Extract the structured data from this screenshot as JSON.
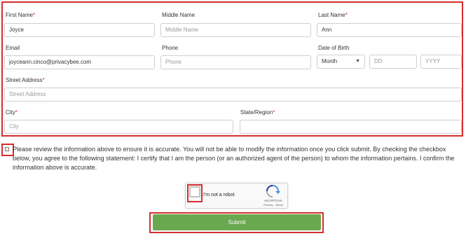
{
  "form": {
    "first_name": {
      "label": "First Name",
      "value": "Joyce"
    },
    "middle_name": {
      "label": "Middle Name",
      "placeholder": "Middle Name"
    },
    "last_name": {
      "label": "Last Name",
      "value": "Ann"
    },
    "email": {
      "label": "Email",
      "value": "joyceann.cinco@privacybee.com"
    },
    "phone": {
      "label": "Phone",
      "placeholder": "Phone"
    },
    "dob": {
      "label": "Date of Birth",
      "month": "Month",
      "day_placeholder": "DD",
      "year_placeholder": "YYYY"
    },
    "street": {
      "label": "Street Address",
      "placeholder": "Street Address"
    },
    "city": {
      "label": "City",
      "placeholder": "City"
    },
    "state": {
      "label": "State/Region",
      "placeholder": ""
    }
  },
  "required_marker": "*",
  "notice": "Please review the information above to ensure it is accurate. You will not be able to modify the information once you click submit. By checking the checkbox below, you agree to the following statement: I certify that I am the person (or an authorized agent of the person) to whom the information pertains. I confirm the information above is accurate.",
  "captcha": {
    "label": "I'm not a robot",
    "brand": "reCAPTCHA",
    "links": "Privacy - Terms"
  },
  "submit_label": "Submit",
  "colors": {
    "accent_red": "#d32f2f",
    "submit_green": "#6aa84f"
  }
}
